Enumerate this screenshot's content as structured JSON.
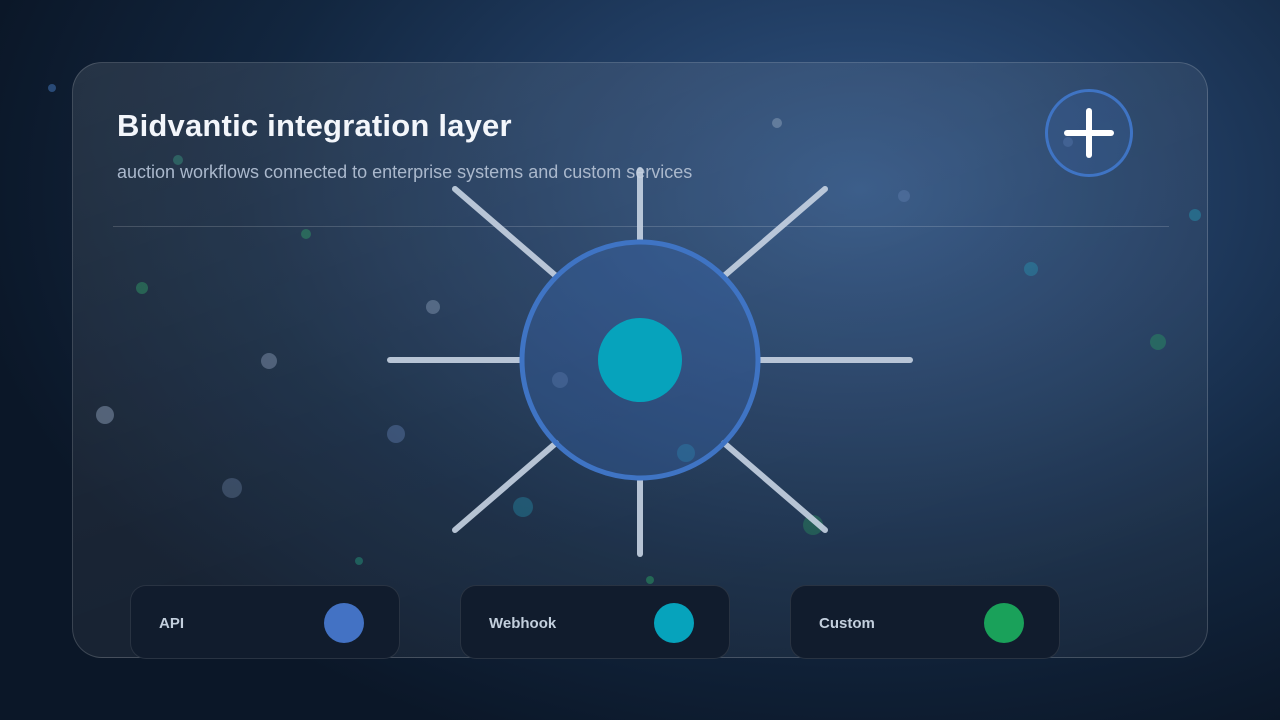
{
  "header": {
    "title": "Bidvantic integration layer",
    "subtitle": "auction workflows connected to enterprise systems and custom services"
  },
  "add_button": {
    "icon": "plus-icon"
  },
  "hub": {
    "center_color": "#06a3bc",
    "ring_color": "#3f74c4",
    "spoke_count": 8
  },
  "integrations": [
    {
      "label": "API",
      "color": "#4372c4"
    },
    {
      "label": "Webhook",
      "color": "#06a3bc"
    },
    {
      "label": "Custom",
      "color": "#1aa15a"
    }
  ]
}
